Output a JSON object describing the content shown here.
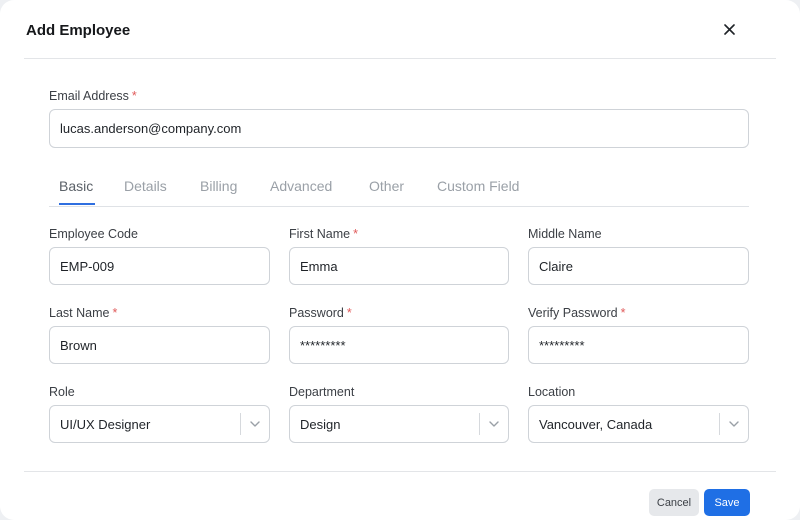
{
  "dialog": {
    "title": "Add Employee",
    "close_icon": "close-icon"
  },
  "email": {
    "label": "Email Address",
    "required_mark": "*",
    "value": "lucas.anderson@company.com"
  },
  "tabs": {
    "items": [
      "Basic",
      "Details",
      "Billing",
      "Advanced",
      "Other",
      "Custom Field"
    ],
    "active": "Basic"
  },
  "fields": {
    "employee_code": {
      "label": "Employee Code",
      "value": "EMP-009"
    },
    "first_name": {
      "label": "First Name",
      "required_mark": "*",
      "value": "Emma"
    },
    "middle_name": {
      "label": "Middle Name",
      "value": "Claire"
    },
    "last_name": {
      "label": "Last Name",
      "required_mark": "*",
      "value": "Brown"
    },
    "password": {
      "label": "Password",
      "required_mark": "*",
      "value": "*********"
    },
    "verify_password": {
      "label": "Verify Password",
      "required_mark": "*",
      "value": "*********"
    },
    "role": {
      "label": "Role",
      "value": "UI/UX Designer",
      "icon": "chevron-down-icon"
    },
    "department": {
      "label": "Department",
      "value": "Design",
      "icon": "chevron-down-icon"
    },
    "location": {
      "label": "Location",
      "value": "Vancouver, Canada",
      "icon": "chevron-down-icon"
    }
  },
  "footer": {
    "cancel_label": "Cancel",
    "save_label": "Save"
  },
  "colors": {
    "accent": "#1f6fe5",
    "required": "#e05a5a",
    "tab_underline": "#2f6fe0"
  }
}
